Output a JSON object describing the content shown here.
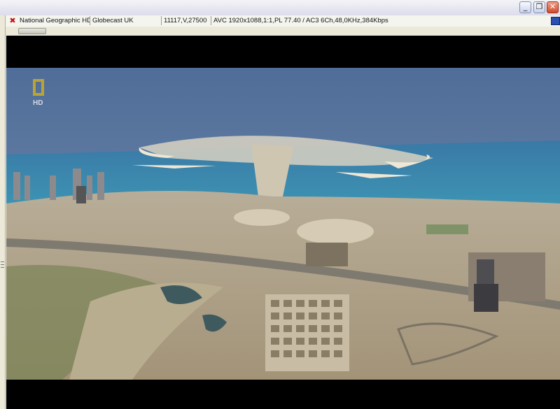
{
  "window": {
    "minimize_icon": "minimize-icon",
    "restore_icon": "restore-icon",
    "close_icon": "close-icon"
  },
  "info": {
    "channel": "National Geographic HD",
    "provider": "Globecast UK",
    "tuning": "11117,V,27500",
    "stream_info": "AVC 1920x1088,1:1,PL 77.40 / AC3 6Ch,48,0KHz,384Kbps"
  },
  "video": {
    "description_icon": "aerial-city-view",
    "watermark": "HD"
  },
  "colors": {
    "logo_yellow": "#e0b410",
    "close_red": "#cf4a2a",
    "sky": "#5e7ba3",
    "sea": "#3d8fb0"
  }
}
